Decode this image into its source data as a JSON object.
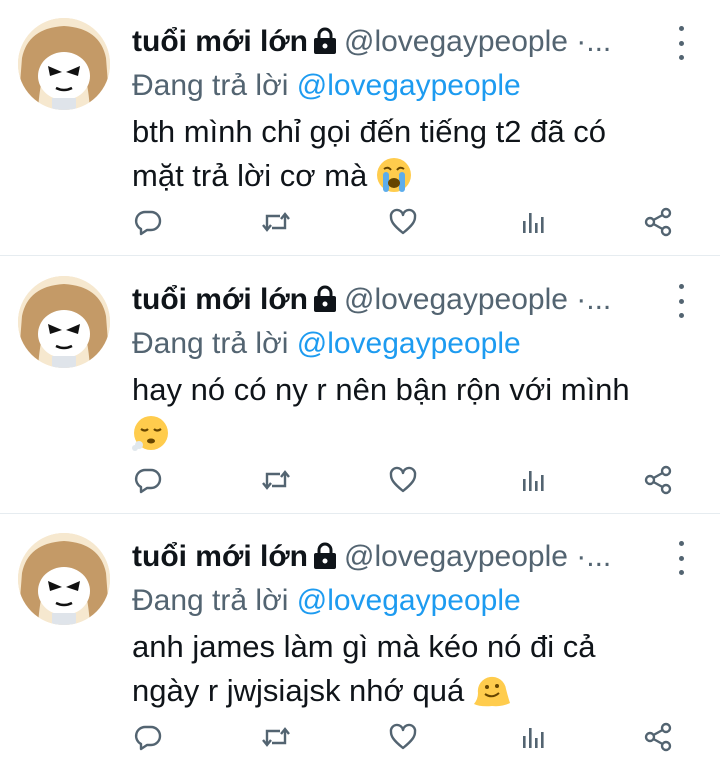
{
  "tweets": [
    {
      "name": "tuổi mới lớn",
      "handle": "@lovegaypeople ·...",
      "reply_prefix": "Đang trả lời",
      "reply_to": "@lovegaypeople",
      "text_line1": "bth mình chỉ gọi đến tiếng t2 đã có",
      "text_line2": "mặt trả lời cơ mà",
      "emoji": "loudly-crying-face"
    },
    {
      "name": "tuổi mới lớn",
      "handle": "@lovegaypeople ·...",
      "reply_prefix": "Đang trả lời",
      "reply_to": "@lovegaypeople",
      "text_line1": "hay nó có ny r nên bận rộn với mình",
      "text_line2": "",
      "emoji": "face-exhaling"
    },
    {
      "name": "tuổi mới lớn",
      "handle": "@lovegaypeople ·...",
      "reply_prefix": "Đang trả lời",
      "reply_to": "@lovegaypeople",
      "text_line1": "anh james làm gì mà kéo nó đi cả",
      "text_line2": "ngày r jwjsiajsk nhớ quá",
      "emoji": "melting-face"
    }
  ],
  "icons": [
    "lock-icon",
    "more-icon",
    "reply-icon",
    "retweet-icon",
    "like-icon",
    "views-icon",
    "share-icon"
  ],
  "colors": {
    "text": "#0f1419",
    "secondary": "#536471",
    "mention": "#1d9bf0",
    "divider": "#e6ecf0"
  }
}
